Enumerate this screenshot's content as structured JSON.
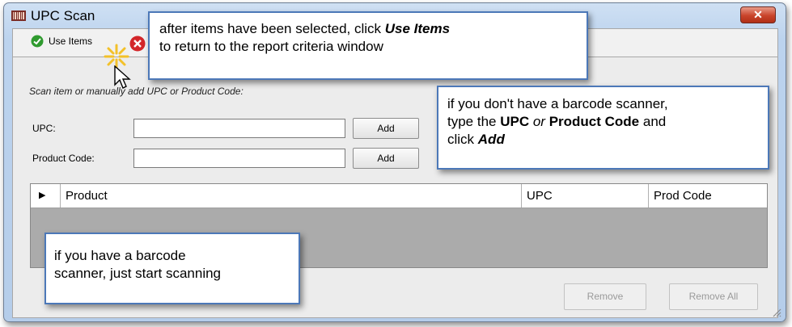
{
  "window": {
    "title": "UPC Scan",
    "close_glyph": "✕"
  },
  "toolbar": {
    "use_items_label": "Use Items"
  },
  "form": {
    "scan_hint": "Scan item or manually add UPC or Product Code:",
    "upc_label": "UPC:",
    "upc_value": "",
    "product_code_label": "Product Code:",
    "product_code_value": "",
    "add_label": "Add"
  },
  "grid": {
    "columns": [
      "Product",
      "UPC",
      "Prod Code"
    ],
    "row_indicator": "▶"
  },
  "footer": {
    "remove_label": "Remove",
    "remove_all_label": "Remove All"
  },
  "callouts": {
    "use_items": {
      "pre": "after items have been selected, click ",
      "bold": "Use Items",
      "post": "to return to the report criteria window"
    },
    "manual": {
      "l1": "if you don't have a barcode scanner,",
      "l2_pre": "type the ",
      "l2_upc": "UPC",
      "l2_or": " or ",
      "l2_pc": "Product Code",
      "l2_post": " and",
      "l3_pre": "click ",
      "l3_add": "Add"
    },
    "scanner": {
      "l1": "if you have a barcode",
      "l2": "scanner, just start scanning"
    }
  },
  "colors": {
    "callout_border": "#4c78b8",
    "close_red": "#c9442b",
    "check_green": "#2f9a2f",
    "cancel_red": "#d3262a"
  }
}
